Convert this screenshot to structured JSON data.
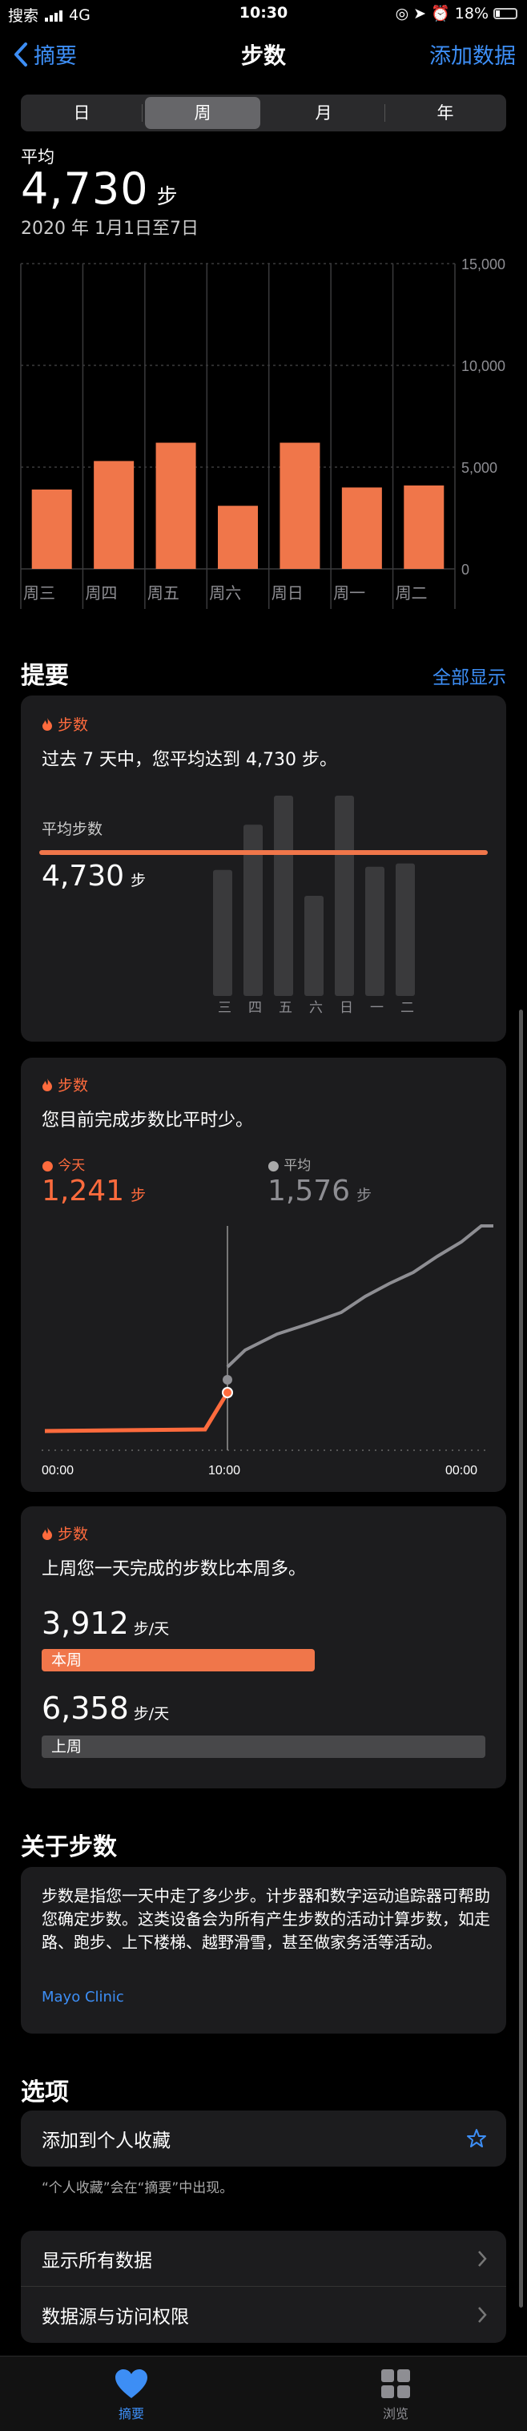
{
  "status_bar": {
    "carrier": "搜索",
    "network": "4G",
    "time": "10:30",
    "battery": "18%"
  },
  "nav": {
    "back_label": "摘要",
    "title": "步数",
    "action_label": "添加数据"
  },
  "segments": [
    {
      "label": "日",
      "selected": false
    },
    {
      "label": "周",
      "selected": true
    },
    {
      "label": "月",
      "selected": false
    },
    {
      "label": "年",
      "selected": false
    }
  ],
  "summary": {
    "label": "平均",
    "value": "4,730",
    "unit": "步",
    "range": "2020 年 1月1日至7日"
  },
  "chart_data": {
    "type": "bar",
    "categories": [
      "周三",
      "周四",
      "周五",
      "周六",
      "周日",
      "周一",
      "周二"
    ],
    "values": [
      3900,
      5300,
      6200,
      3100,
      6200,
      4000,
      4100
    ],
    "ylim": [
      0,
      15000
    ],
    "y_ticks": [
      "15,000",
      "10,000",
      "5,000",
      "0"
    ],
    "y_tick_values": [
      15000,
      10000,
      5000,
      0
    ],
    "color": "#f0764a",
    "grid": true
  },
  "highlights": {
    "title": "提要",
    "show_all": "全部显示",
    "card1": {
      "tag": "步数",
      "text": "过去 7 天中，您平均达到 4,730 步。",
      "avg_label": "平均步数",
      "avg_value": "4,730",
      "unit": "步",
      "day_labels": [
        "三",
        "四",
        "五",
        "六",
        "日",
        "一",
        "二"
      ],
      "values": [
        3900,
        5300,
        6200,
        3100,
        6200,
        4000,
        4100
      ],
      "avg_line_value": 4730
    },
    "card2": {
      "tag": "步数",
      "text": "您目前完成步数比平时少。",
      "today_label": "今天",
      "today_value": "1,241",
      "avg_label": "平均",
      "avg_value": "1,576",
      "unit": "步",
      "x_labels": [
        "00:00",
        "10:00",
        "00:00"
      ]
    },
    "card3": {
      "tag": "步数",
      "text": "上周您一天完成的步数比本周多。",
      "this_week_value": "3,912",
      "this_week_unit": "步/天",
      "this_week_label": "本周",
      "this_week_fraction": 0.615,
      "last_week_value": "6,358",
      "last_week_unit": "步/天",
      "last_week_label": "上周",
      "last_week_fraction": 1.0
    }
  },
  "about": {
    "title": "关于步数",
    "body": "步数是指您一天中走了多少步。计步器和数字运动追踪器可帮助您确定步数。这类设备会为所有产生步数的活动计算步数，如走路、跑步、上下楼梯、越野滑雪，甚至做家务活等活动。",
    "source": "Mayo Clinic"
  },
  "options": {
    "title": "选项",
    "favorite_label": "添加到个人收藏",
    "favorite_note": "“个人收藏”会在“摘要”中出现。",
    "show_all_data": "显示所有数据",
    "sources_access": "数据源与访问权限"
  },
  "tab_bar": [
    {
      "label": "摘要",
      "active": true,
      "icon": "heart-icon"
    },
    {
      "label": "浏览",
      "active": false,
      "icon": "grid-icon"
    }
  ],
  "colors": {
    "accent": "#3d8ef5",
    "steps": "#f0764a",
    "card": "#1c1c1e"
  }
}
